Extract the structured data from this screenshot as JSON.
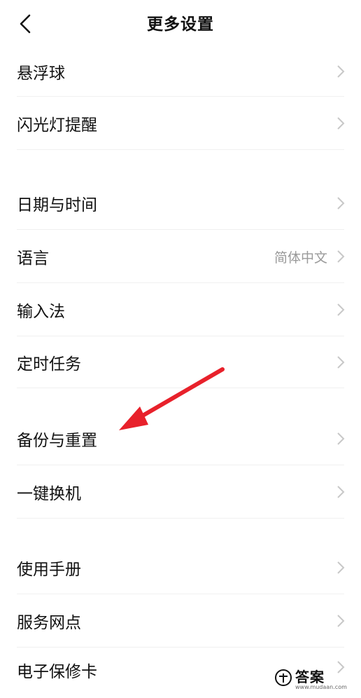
{
  "header": {
    "title": "更多设置",
    "back_icon": "chevron-left-icon"
  },
  "items": [
    {
      "label": "悬浮球",
      "value": ""
    },
    {
      "label": "闪光灯提醒",
      "value": ""
    },
    {
      "label": "日期与时间",
      "value": ""
    },
    {
      "label": "语言",
      "value": "简体中文"
    },
    {
      "label": "输入法",
      "value": ""
    },
    {
      "label": "定时任务",
      "value": ""
    },
    {
      "label": "备份与重置",
      "value": ""
    },
    {
      "label": "一键换机",
      "value": ""
    },
    {
      "label": "使用手册",
      "value": ""
    },
    {
      "label": "服务网点",
      "value": ""
    },
    {
      "label": "电子保修卡",
      "value": ""
    }
  ],
  "watermark": {
    "text": "答案",
    "sub": "www.mudaan.com"
  },
  "colors": {
    "annotation_arrow": "#e8212b",
    "value_text": "#9a9a9a",
    "chevron": "#c8c8c8"
  }
}
